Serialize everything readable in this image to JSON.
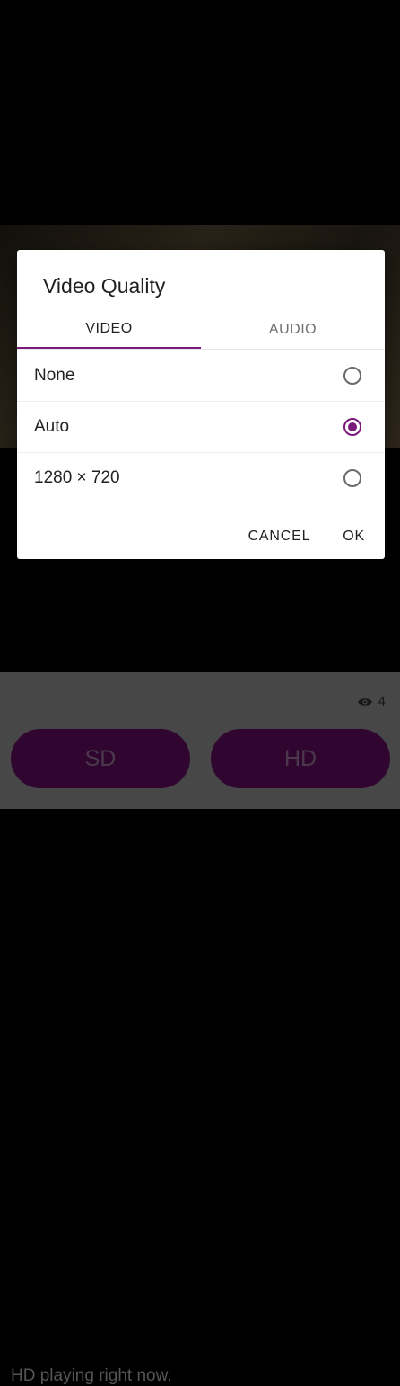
{
  "player": {
    "status_text": "HD playing right now.",
    "viewer_count": "4",
    "viewer_icon": "eye-icon",
    "sd_label": "SD",
    "hd_label": "HD"
  },
  "dialog": {
    "title": "Video Quality",
    "tabs": [
      {
        "label": "VIDEO",
        "active": true
      },
      {
        "label": "AUDIO",
        "active": false
      }
    ],
    "options": [
      {
        "label": "None",
        "selected": false
      },
      {
        "label": "Auto",
        "selected": true
      },
      {
        "label": "1280 × 720",
        "selected": false
      }
    ],
    "cancel_label": "CANCEL",
    "ok_label": "OK"
  },
  "colors": {
    "accent": "#7b1a7b",
    "button_bg": "#6b0f6b"
  }
}
